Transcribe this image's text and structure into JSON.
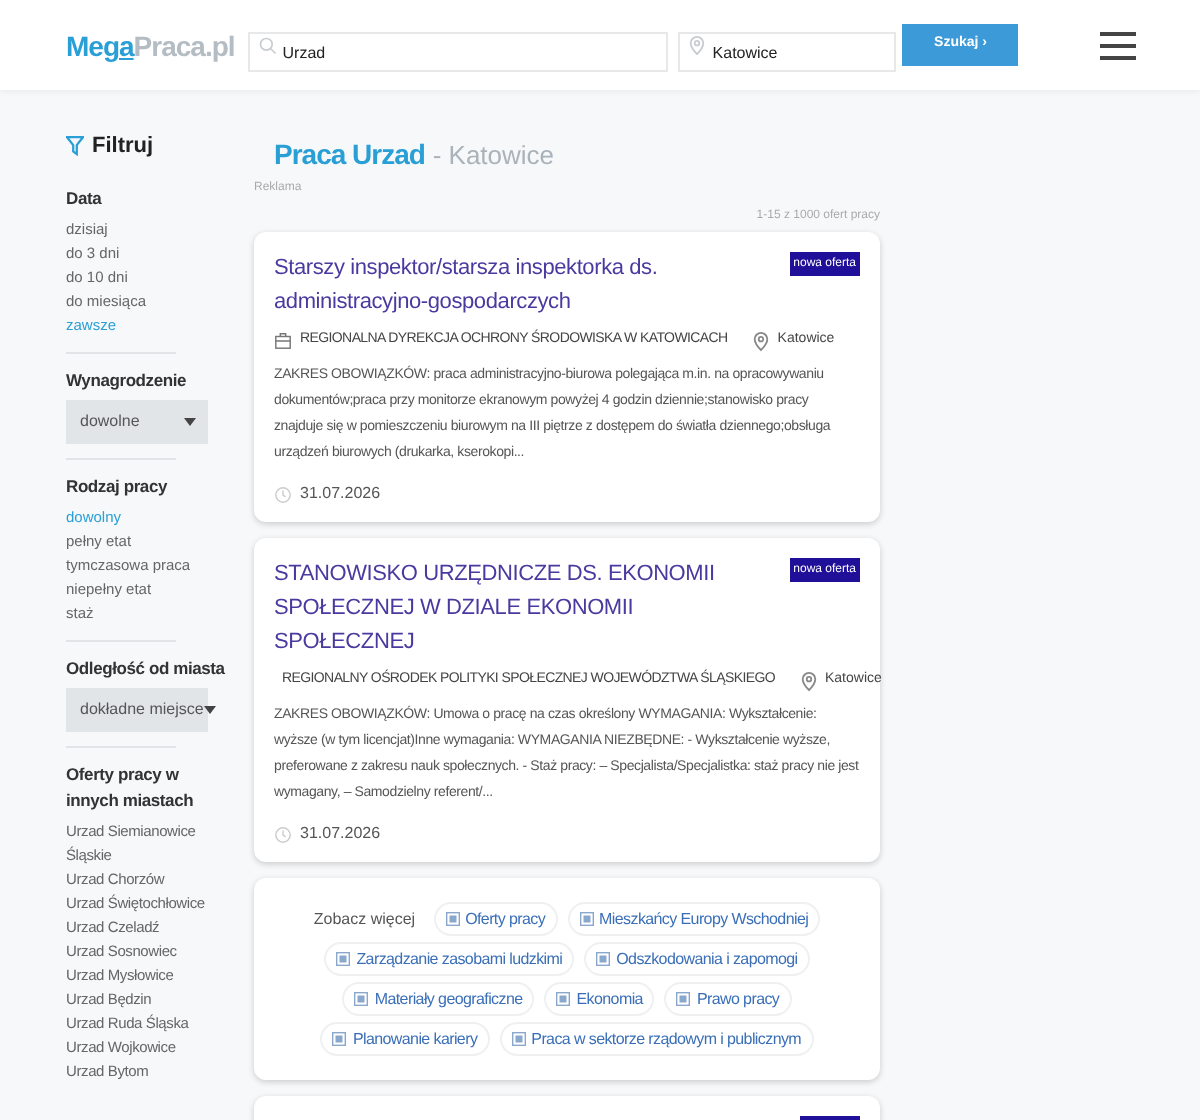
{
  "header": {
    "logo": {
      "part_1": "Meg",
      "part_2": "a",
      "part_3": "Praca.pl"
    },
    "search": {
      "value": "Urzad"
    },
    "location": {
      "value": "Katowice"
    },
    "search_button": "Szukaj ›"
  },
  "sidebar": {
    "title": "Filtruj",
    "sections": [
      {
        "kind": "options",
        "title": "Data",
        "options": [
          {
            "label": "dzisiaj",
            "selected": false
          },
          {
            "label": "do 3 dni",
            "selected": false
          },
          {
            "label": "do 10 dni",
            "selected": false
          },
          {
            "label": "do miesiąca",
            "selected": false
          },
          {
            "label": "zawsze",
            "selected": true
          }
        ]
      },
      {
        "kind": "select",
        "title": "Wynagrodzenie",
        "value": "dowolne"
      },
      {
        "kind": "options",
        "title": "Rodzaj pracy",
        "options": [
          {
            "label": "dowolny",
            "selected": true
          },
          {
            "label": "pełny etat",
            "selected": false
          },
          {
            "label": "tymczasowa praca",
            "selected": false
          },
          {
            "label": "niepełny etat",
            "selected": false
          },
          {
            "label": "staż",
            "selected": false
          }
        ]
      },
      {
        "kind": "select",
        "title": "Odległość od miasta",
        "value": "dokładne miejsce"
      },
      {
        "kind": "links",
        "title": "Oferty pracy w innych miastach",
        "links": [
          "Urzad Siemianowice Śląskie",
          "Urzad Chorzów",
          "Urzad Świętochłowice",
          "Urzad Czeladź",
          "Urzad Sosnowiec",
          "Urzad Mysłowice",
          "Urzad Będzin",
          "Urzad Ruda Śląska",
          "Urzad Wojkowice",
          "Urzad Bytom"
        ]
      }
    ]
  },
  "main": {
    "heading": "Praca Urzad",
    "heading_location": "- Katowice",
    "ad_label": "Reklama",
    "count": "1-15 z 1000 ofert pracy",
    "jobs": [
      {
        "title": "Starszy inspektor/starsza inspektorka ds. administracyjno-gospodarczych",
        "badge": "nowa oferta",
        "company": "REGIONALNA DYREKCJA OCHRONY ŚRODOWISKA W KATOWICACH",
        "location": "Katowice",
        "description": "ZAKRES OBOWIĄZKÓW: praca administracyjno-biurowa polegająca m.in. na opracowywaniu dokumentów;praca przy monitorze ekranowym powyżej 4 godzin dziennie;stanowisko pracy znajduje się w pomieszczeniu biurowym na III piętrze z dostępem do światła dziennego;obsługa urządzeń biurowych (drukarka, kserokopi...",
        "date": "31.07.2026"
      },
      {
        "title": "STANOWISKO URZĘDNICZE DS. EKONOMII SPOŁECZNEJ W DZIALE EKONOMII SPOŁECZNEJ",
        "badge": "nowa oferta",
        "company": "REGIONALNY OŚRODEK POLITYKI SPOŁECZNEJ WOJEWÓDZTWA ŚLĄSKIEGO",
        "location": "Katowice",
        "description": "ZAKRES OBOWIĄZKÓW: Umowa o pracę na czas określony WYMAGANIA: Wykształcenie: wyższe (w tym licencjat)Inne wymagania: WYMAGANIA NIEZBĘDNE: - Wykształcenie wyższe, preferowane z zakresu nauk społecznych. - Staż pracy: – Specjalista/Specjalistka: staż pracy nie jest wymagany, – Samodzielny referent/...",
        "date": "31.07.2026"
      }
    ],
    "see_more": {
      "label": "Zobacz więcej",
      "tags": [
        "Oferty pracy",
        "Mieszkańcy Europy Wschodniej",
        "Zarządzanie zasobami ludzkimi",
        "Odszkodowania i zapomogi",
        "Materiały geograficzne",
        "Ekonomia",
        "Prawo pracy",
        "Planowanie kariery",
        "Praca w sektorze rządowym i publicznym"
      ]
    }
  }
}
